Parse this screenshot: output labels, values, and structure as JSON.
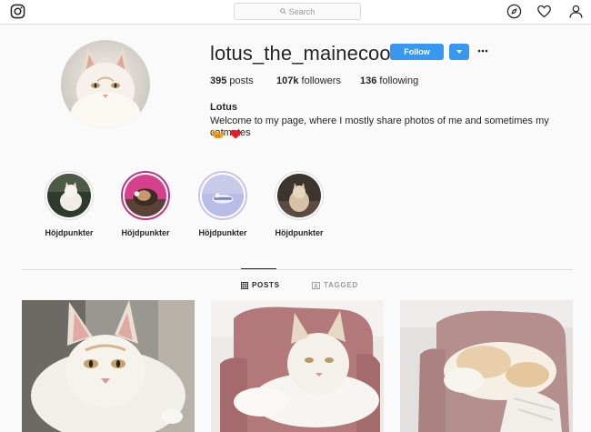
{
  "topbar": {
    "search_placeholder": "Search",
    "icons": [
      "instagram-logo-icon",
      "search-icon",
      "compass-icon",
      "heart-icon",
      "person-icon"
    ]
  },
  "profile": {
    "username": "lotus_the_mainecoon",
    "follow_label": "Follow",
    "stats": {
      "posts_count": "395",
      "posts_label": " posts",
      "followers_count": "107k",
      "followers_label": " followers",
      "following_count": "136",
      "following_label": " following"
    },
    "full_name": "Lotus",
    "bio": "Welcome to my page, where I mostly share photos of me and sometimes my catmates",
    "bio_emojis": [
      "cat-emoji",
      "red-heart-emoji"
    ]
  },
  "highlights": [
    {
      "label": "Höjdpunkter"
    },
    {
      "label": "Höjdpunkter"
    },
    {
      "label": "Höjdpunkter"
    },
    {
      "label": "Höjdpunkter"
    }
  ],
  "tabs": {
    "posts_label": "POSTS",
    "tagged_label": "TAGGED"
  },
  "colors": {
    "accent": "#3897f0",
    "border": "#dbdbdb",
    "background": "#fafafa",
    "text": "#262626",
    "heart": "#ed1c24"
  }
}
